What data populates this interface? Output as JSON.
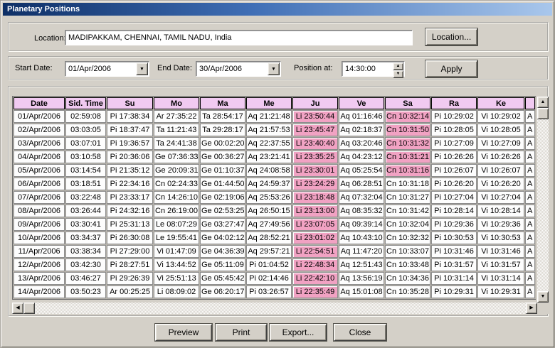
{
  "window": {
    "title": "Planetary Positions"
  },
  "colors": {
    "titlebar-left": "#0e2f66",
    "titlebar-right": "#a9c7ec",
    "dialog-bg": "#d4d0c8",
    "header-bg": "#f1caf1",
    "highlight-bg": "#f1a2c3",
    "cell-bg": "#fdfdfd"
  },
  "location": {
    "label": "Location:",
    "value": "MADIPAKKAM, CHENNAI, TAMIL NADU, India",
    "button_label": "Location..."
  },
  "filters": {
    "start_label": "Start Date:",
    "start_value": "01/Apr/2006",
    "end_label": "End Date:",
    "end_value": "30/Apr/2006",
    "position_label": "Position at:",
    "position_value": "14:30:00",
    "apply_label": "Apply"
  },
  "grid": {
    "columns": [
      "Date",
      "Sid. Time",
      "Su",
      "Mo",
      "Ma",
      "Me",
      "Ju",
      "Ve",
      "Sa",
      "Ra",
      "Ke"
    ],
    "partial_column_text": "A",
    "rows": [
      {
        "cells": [
          "01/Apr/2006",
          "02:59:08",
          "Pi 17:38:34",
          "Ar 27:35:22",
          "Ta 28:54:17",
          "Aq 21:21:48",
          "Li 23:50:44",
          "Aq 01:16:46",
          "Cn 10:32:14",
          "Pi 10:29:02",
          "Vi 10:29:02"
        ],
        "highlighted_columns": [
          "Ju",
          "Sa"
        ]
      },
      {
        "cells": [
          "02/Apr/2006",
          "03:03:05",
          "Pi 18:37:47",
          "Ta 11:21:43",
          "Ta 29:28:17",
          "Aq 21:57:53",
          "Li 23:45:47",
          "Aq 02:18:37",
          "Cn 10:31:50",
          "Pi 10:28:05",
          "Vi 10:28:05"
        ],
        "highlighted_columns": [
          "Ju",
          "Sa"
        ]
      },
      {
        "cells": [
          "03/Apr/2006",
          "03:07:01",
          "Pi 19:36:57",
          "Ta 24:41:38",
          "Ge 00:02:20",
          "Aq 22:37:55",
          "Li 23:40:40",
          "Aq 03:20:46",
          "Cn 10:31:32",
          "Pi 10:27:09",
          "Vi 10:27:09"
        ],
        "highlighted_columns": [
          "Ju",
          "Sa"
        ]
      },
      {
        "cells": [
          "04/Apr/2006",
          "03:10:58",
          "Pi 20:36:06",
          "Ge 07:36:33",
          "Ge 00:36:27",
          "Aq 23:21:41",
          "Li 23:35:25",
          "Aq 04:23:12",
          "Cn 10:31:21",
          "Pi 10:26:26",
          "Vi 10:26:26"
        ],
        "highlighted_columns": [
          "Ju",
          "Sa"
        ]
      },
      {
        "cells": [
          "05/Apr/2006",
          "03:14:54",
          "Pi 21:35:12",
          "Ge 20:09:31",
          "Ge 01:10:37",
          "Aq 24:08:58",
          "Li 23:30:01",
          "Aq 05:25:54",
          "Cn 10:31:16",
          "Pi 10:26:07",
          "Vi 10:26:07"
        ],
        "highlighted_columns": [
          "Ju",
          "Sa"
        ]
      },
      {
        "cells": [
          "06/Apr/2006",
          "03:18:51",
          "Pi 22:34:16",
          "Cn 02:24:33",
          "Ge 01:44:50",
          "Aq 24:59:37",
          "Li 23:24:29",
          "Aq 06:28:51",
          "Cn 10:31:18",
          "Pi 10:26:20",
          "Vi 10:26:20"
        ],
        "highlighted_columns": [
          "Ju"
        ]
      },
      {
        "cells": [
          "07/Apr/2006",
          "03:22:48",
          "Pi 23:33:17",
          "Cn 14:26:10",
          "Ge 02:19:06",
          "Aq 25:53:26",
          "Li 23:18:48",
          "Aq 07:32:04",
          "Cn 10:31:27",
          "Pi 10:27:04",
          "Vi 10:27:04"
        ],
        "highlighted_columns": [
          "Ju"
        ]
      },
      {
        "cells": [
          "08/Apr/2006",
          "03:26:44",
          "Pi 24:32:16",
          "Cn 26:19:00",
          "Ge 02:53:25",
          "Aq 26:50:15",
          "Li 23:13:00",
          "Aq 08:35:32",
          "Cn 10:31:42",
          "Pi 10:28:14",
          "Vi 10:28:14"
        ],
        "highlighted_columns": [
          "Ju"
        ]
      },
      {
        "cells": [
          "09/Apr/2006",
          "03:30:41",
          "Pi 25:31:13",
          "Le 08:07:29",
          "Ge 03:27:47",
          "Aq 27:49:56",
          "Li 23:07:05",
          "Aq 09:39:14",
          "Cn 10:32:04",
          "Pi 10:29:36",
          "Vi 10:29:36"
        ],
        "highlighted_columns": [
          "Ju"
        ]
      },
      {
        "cells": [
          "10/Apr/2006",
          "03:34:37",
          "Pi 26:30:08",
          "Le 19:55:41",
          "Ge 04:02:12",
          "Aq 28:52:21",
          "Li 23:01:02",
          "Aq 10:43:10",
          "Cn 10:32:32",
          "Pi 10:30:53",
          "Vi 10:30:53"
        ],
        "highlighted_columns": [
          "Ju"
        ]
      },
      {
        "cells": [
          "11/Apr/2006",
          "03:38:34",
          "Pi 27:29:00",
          "Vi 01:47:09",
          "Ge 04:36:39",
          "Aq 29:57:21",
          "Li 22:54:51",
          "Aq 11:47:20",
          "Cn 10:33:07",
          "Pi 10:31:46",
          "Vi 10:31:46"
        ],
        "highlighted_columns": [
          "Ju"
        ]
      },
      {
        "cells": [
          "12/Apr/2006",
          "03:42:30",
          "Pi 28:27:51",
          "Vi 13:44:52",
          "Ge 05:11:09",
          "Pi 01:04:52",
          "Li 22:48:34",
          "Aq 12:51:43",
          "Cn 10:33:48",
          "Pi 10:31:57",
          "Vi 10:31:57"
        ],
        "highlighted_columns": [
          "Ju"
        ]
      },
      {
        "cells": [
          "13/Apr/2006",
          "03:46:27",
          "Pi 29:26:39",
          "Vi 25:51:13",
          "Ge 05:45:42",
          "Pi 02:14:46",
          "Li 22:42:10",
          "Aq 13:56:19",
          "Cn 10:34:36",
          "Pi 10:31:14",
          "Vi 10:31:14"
        ],
        "highlighted_columns": [
          "Ju"
        ]
      },
      {
        "cells": [
          "14/Apr/2006",
          "03:50:23",
          "Ar 00:25:25",
          "Li 08:09:02",
          "Ge 06:20:17",
          "Pi 03:26:57",
          "Li 22:35:49",
          "Aq 15:01:08",
          "Cn 10:35:28",
          "Pi 10:29:31",
          "Vi 10:29:31"
        ],
        "highlighted_columns": [
          "Ju"
        ]
      }
    ]
  },
  "footer": {
    "buttons": [
      "Preview",
      "Print",
      "Export...",
      "Close"
    ]
  }
}
